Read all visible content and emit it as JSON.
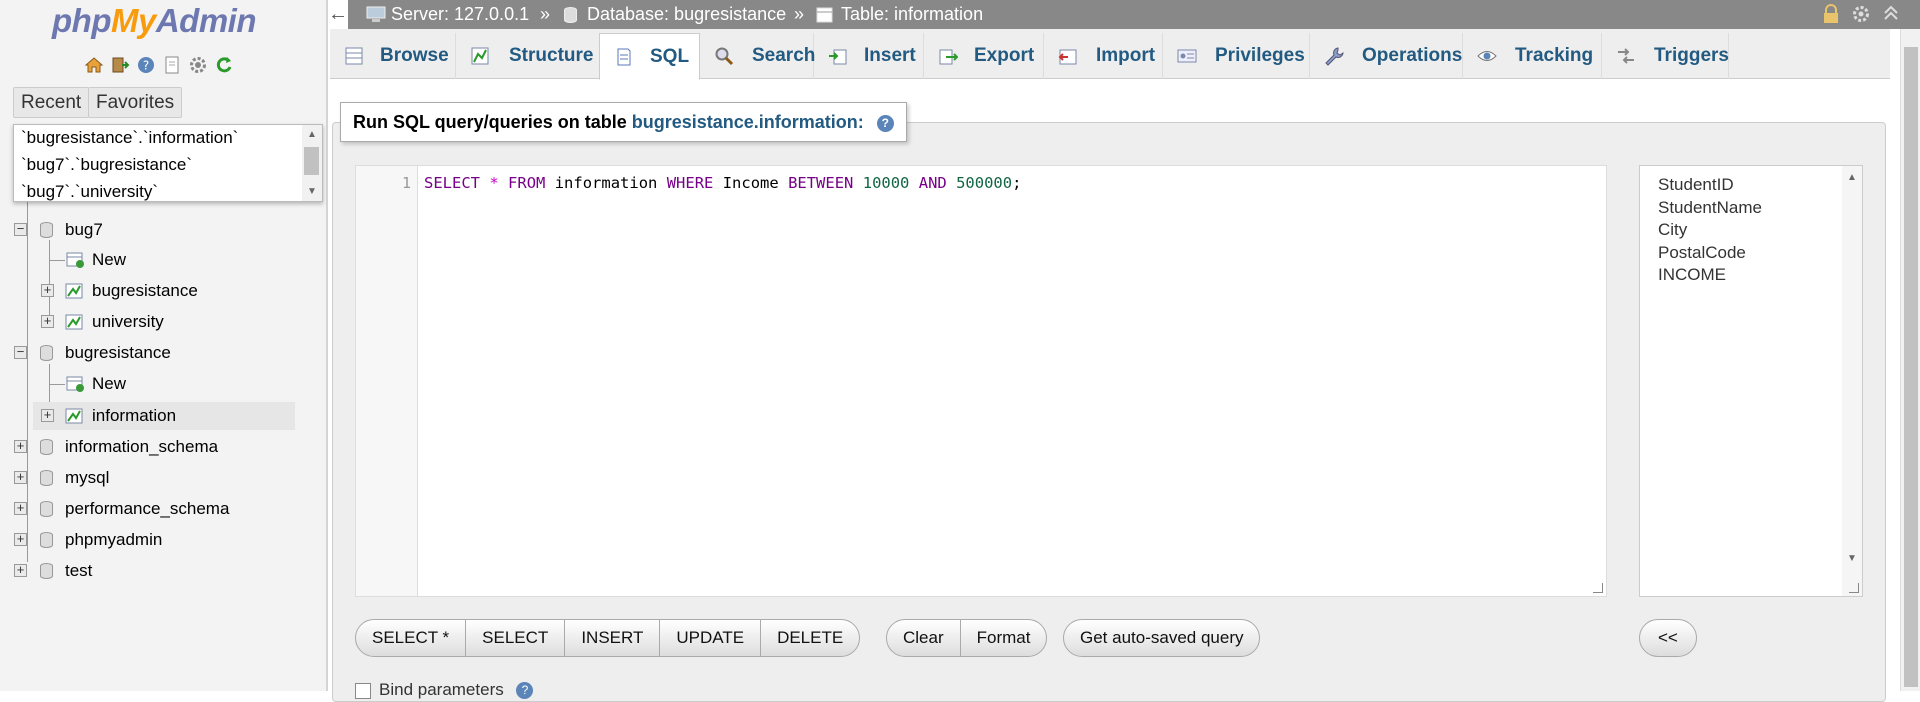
{
  "nav": {
    "logo_php": "php",
    "logo_my": "My",
    "logo_admin": "Admin",
    "tabs": {
      "recent": "Recent",
      "favorites": "Favorites"
    },
    "recent_items": [
      "`bugresistance`.`information`",
      "`bug7`.`bugresistance`",
      "`bug7`.`university`"
    ],
    "tree": {
      "bug7": "bug7",
      "bug7_new": "New",
      "bug7_bugresistance": "bugresistance",
      "bug7_university": "university",
      "bugresistance": "bugresistance",
      "bugresistance_new": "New",
      "bugresistance_information": "information",
      "information_schema": "information_schema",
      "mysql": "mysql",
      "performance_schema": "performance_schema",
      "phpmyadmin": "phpmyadmin",
      "test": "test"
    }
  },
  "breadcrumb": {
    "server": "Server: 127.0.0.1",
    "sep1": "»",
    "database": "Database: bugresistance",
    "sep2": "»",
    "table": "Table: information"
  },
  "tabs": {
    "browse": "Browse",
    "structure": "Structure",
    "sql": "SQL",
    "search": "Search",
    "insert": "Insert",
    "export": "Export",
    "import": "Import",
    "privileges": "Privileges",
    "operations": "Operations",
    "tracking": "Tracking",
    "triggers": "Triggers"
  },
  "query_box": {
    "legend_prefix": "Run SQL query/queries on table",
    "legend_table": "bugresistance.information:",
    "line_number": "1",
    "sql": {
      "select": "SELECT",
      "star": "*",
      "from": "FROM",
      "table": "information",
      "where": "WHERE",
      "column": "Income",
      "between": "BETWEEN",
      "low": "10000",
      "and": "AND",
      "high": "500000",
      "end": ";"
    }
  },
  "columns": [
    "StudentID",
    "StudentName",
    "City",
    "PostalCode",
    "INCOME"
  ],
  "buttons": {
    "select_star": "SELECT *",
    "select": "SELECT",
    "insert": "INSERT",
    "update": "UPDATE",
    "delete": "DELETE",
    "clear": "Clear",
    "format": "Format",
    "autosaved": "Get auto-saved query",
    "collapse": "<<"
  },
  "bind_parameters": "Bind parameters",
  "colors": {
    "link_blue": "#235a81",
    "sql_keyword": "#770088",
    "sql_number": "#116644",
    "topbar": "#888888"
  }
}
